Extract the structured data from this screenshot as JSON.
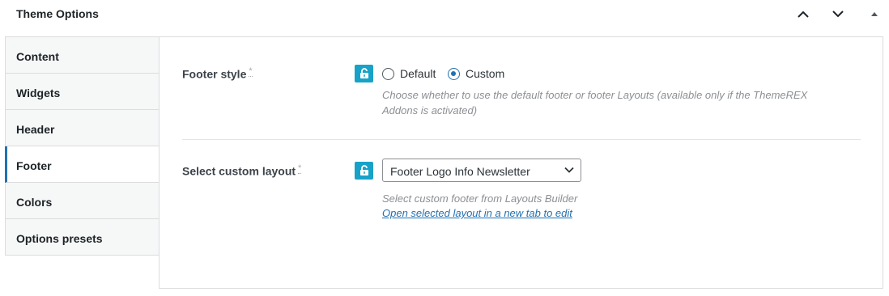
{
  "header": {
    "title": "Theme Options"
  },
  "tabs": [
    {
      "label": "Content"
    },
    {
      "label": "Widgets"
    },
    {
      "label": "Header"
    },
    {
      "label": "Footer",
      "active": true
    },
    {
      "label": "Colors"
    },
    {
      "label": "Options presets"
    }
  ],
  "footer_style": {
    "label": "Footer style",
    "required_mark": "*",
    "options": [
      "Default",
      "Custom"
    ],
    "selected": "Custom",
    "description": "Choose whether to use the default footer or footer Layouts (available only if the ThemeREX Addons is activated)"
  },
  "custom_layout": {
    "label": "Select custom layout",
    "required_mark": "*",
    "selected_value": "Footer Logo Info Newsletter",
    "description": "Select custom footer from Layouts Builder",
    "link_text": "Open selected layout in a new tab to edit"
  },
  "colors": {
    "accent": "#2271b1",
    "lock_button": "#18a2c8"
  }
}
